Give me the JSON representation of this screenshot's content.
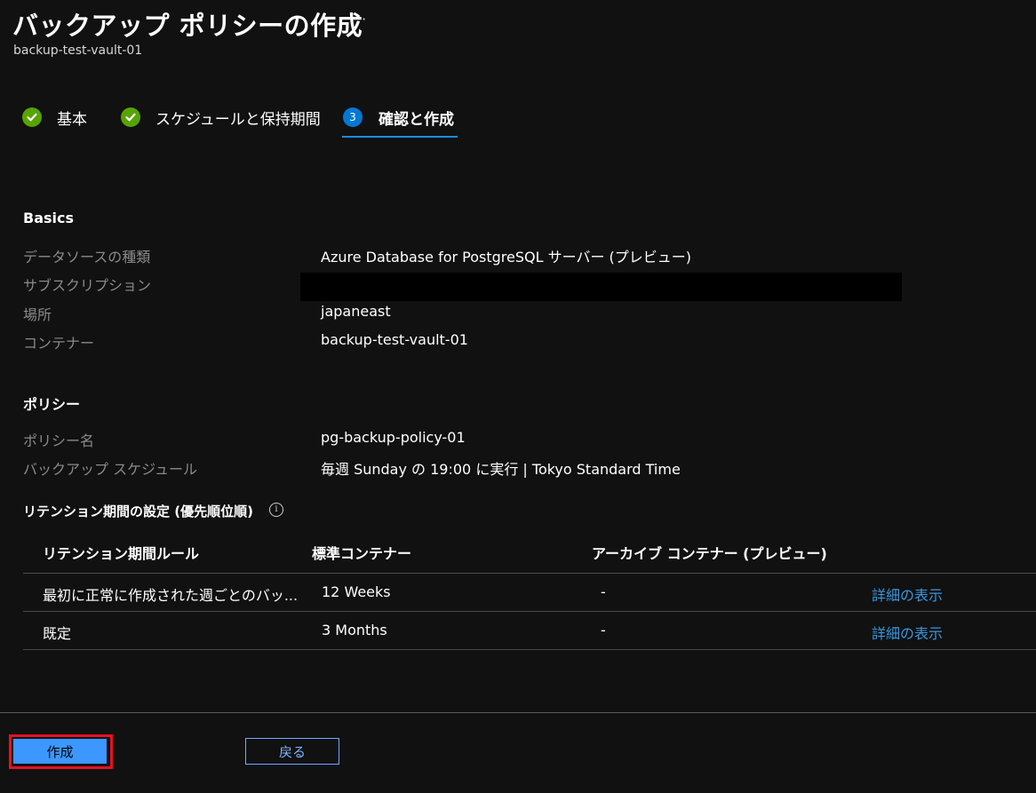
{
  "header": {
    "title": "バックアップ ポリシーの作成",
    "more_icon": "ellipsis-icon",
    "subtitle": "backup-test-vault-01"
  },
  "steps": [
    {
      "label": "基本",
      "status": "complete"
    },
    {
      "label": "スケジュールと保持期間",
      "status": "complete"
    },
    {
      "label": "確認と作成",
      "status": "current",
      "number": "3"
    }
  ],
  "basics": {
    "heading": "Basics",
    "rows": [
      {
        "label": "データソースの種類",
        "value": "Azure Database for PostgreSQL サーバー (プレビュー)"
      },
      {
        "label": "サブスクリプション",
        "value": ""
      },
      {
        "label": "場所",
        "value": "japaneast"
      },
      {
        "label": "コンテナー",
        "value": "backup-test-vault-01"
      }
    ]
  },
  "policy": {
    "heading": "ポリシー",
    "rows": [
      {
        "label": "ポリシー名",
        "value": "pg-backup-policy-01"
      },
      {
        "label": "バックアップ スケジュール",
        "value": "毎週 Sunday の 19:00 に実行 | Tokyo Standard Time"
      }
    ]
  },
  "retention": {
    "heading": "リテンション期間の設定 (優先順位順)",
    "info_icon": "info-icon",
    "columns": [
      "リテンション期間ルール",
      "標準コンテナー",
      "アーカイブ コンテナー (プレビュー)"
    ],
    "rows": [
      {
        "rule": "最初に正常に作成された週ごとのバッ...",
        "standard": "12 Weeks",
        "archive": "-",
        "link": "詳細の表示"
      },
      {
        "rule": "既定",
        "standard": "3 Months",
        "archive": "-",
        "link": "詳細の表示"
      }
    ]
  },
  "footer": {
    "create_label": "作成",
    "back_label": "戻る"
  },
  "colors": {
    "background": "#111111",
    "check_green": "#57a300",
    "step_blue": "#0078d4",
    "link_blue": "#3a96dd",
    "primary_button": "#3c97ff",
    "highlight_red": "#e81123"
  }
}
